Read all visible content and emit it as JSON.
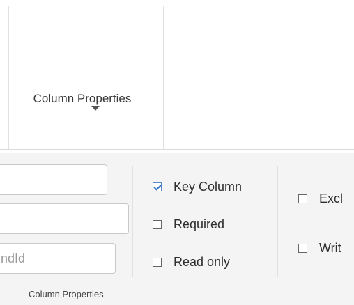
{
  "ribbon": {
    "big_button_label": "Column Properties"
  },
  "fields": {
    "field1_value": "",
    "field2_value": "",
    "field3_value": "ndId"
  },
  "checkboxes": [
    {
      "label": "Key Column",
      "checked": true
    },
    {
      "label": "Required",
      "checked": false
    },
    {
      "label": "Read only",
      "checked": false
    },
    {
      "label": "Excl",
      "checked": false
    },
    {
      "label": "Writ",
      "checked": false
    }
  ],
  "group": {
    "caption": "Column Properties"
  }
}
